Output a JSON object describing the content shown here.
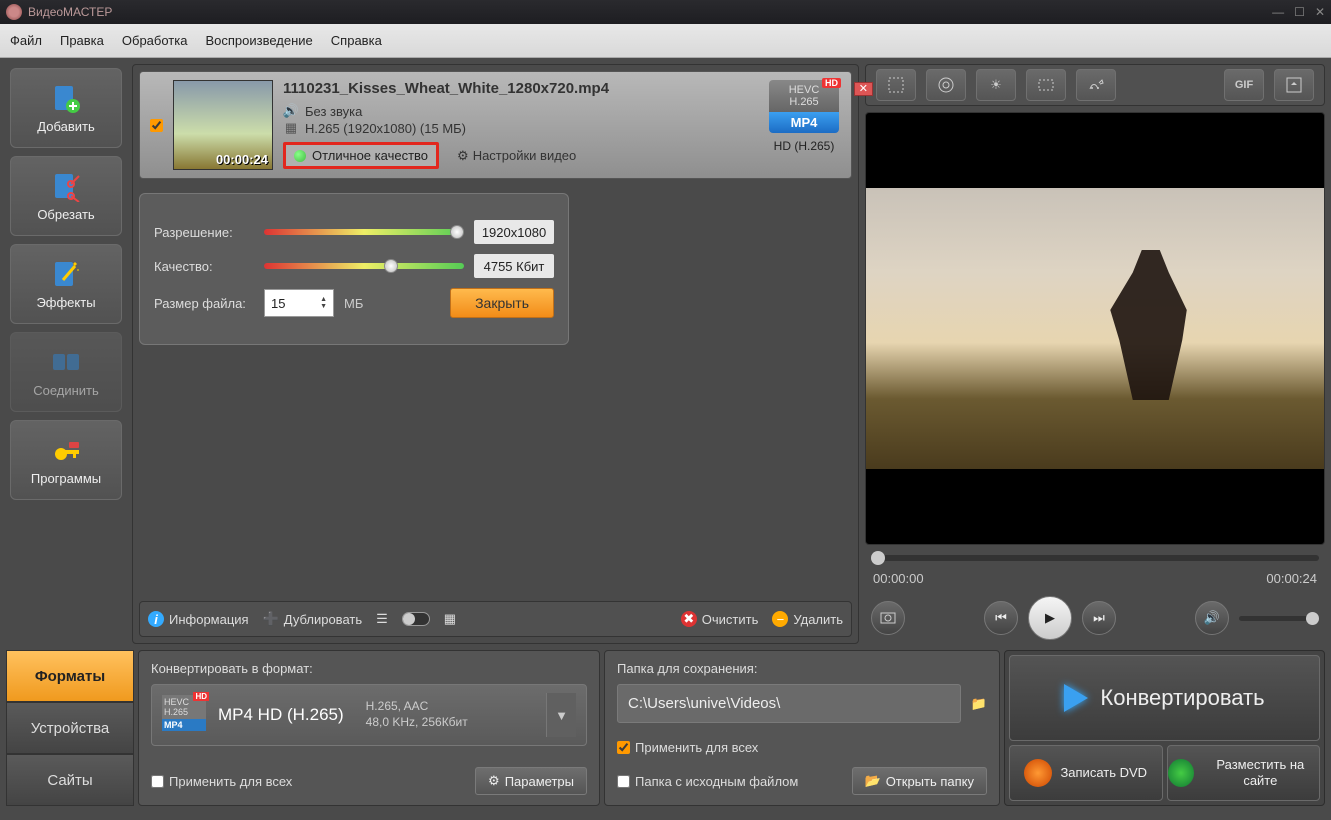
{
  "window": {
    "title": "ВидеоМАСТЕР"
  },
  "menu": [
    "Файл",
    "Правка",
    "Обработка",
    "Воспроизведение",
    "Справка"
  ],
  "left_tools": [
    {
      "name": "add",
      "label": "Добавить"
    },
    {
      "name": "trim",
      "label": "Обрезать"
    },
    {
      "name": "effects",
      "label": "Эффекты"
    },
    {
      "name": "join",
      "label": "Соединить",
      "disabled": true
    },
    {
      "name": "programs",
      "label": "Программы"
    }
  ],
  "file": {
    "name": "1110231_Kisses_Wheat_White_1280x720.mp4",
    "audio": "Без звука",
    "format": "H.265 (1920x1080) (15 МБ)",
    "quality_label": "Отличное качество",
    "settings_label": "Настройки видео",
    "codec_top": "HEVC",
    "codec_mid": "H.265",
    "codec_container": "MP4",
    "codec_sub": "HD (H.265)",
    "hd": "HD",
    "duration": "00:00:24"
  },
  "quality_panel": {
    "resolution_lbl": "Разрешение:",
    "resolution_val": "1920x1080",
    "quality_lbl": "Качество:",
    "quality_val": "4755 Кбит",
    "size_lbl": "Размер файла:",
    "size_val": "15",
    "size_unit": "МБ",
    "close": "Закрыть"
  },
  "center_bar": {
    "info": "Информация",
    "dup": "Дублировать",
    "clear": "Очистить",
    "delete": "Удалить"
  },
  "preview_tools": [
    "crop",
    "round",
    "brightness",
    "stabilize",
    "speed",
    "gif",
    "fullscreen"
  ],
  "preview_tools_gif": "GIF",
  "playback": {
    "current": "00:00:00",
    "total": "00:00:24"
  },
  "side_tabs": [
    {
      "name": "formats",
      "label": "Форматы",
      "active": true
    },
    {
      "name": "devices",
      "label": "Устройства"
    },
    {
      "name": "sites",
      "label": "Сайты"
    }
  ],
  "convert": {
    "hdr": "Конвертировать в формат:",
    "name": "MP4 HD (H.265)",
    "line1": "H.265, AAC",
    "line2": "48,0 KHz, 256Кбит",
    "apply_all": "Применить для всех",
    "params": "Параметры"
  },
  "save": {
    "hdr": "Папка для сохранения:",
    "path": "C:\\Users\\unive\\Videos\\",
    "apply_all": "Применить для всех",
    "source": "Папка с исходным файлом",
    "open": "Открыть папку"
  },
  "actions": {
    "convert": "Конвертировать",
    "dvd": "Записать DVD",
    "upload": "Разместить на сайте"
  }
}
